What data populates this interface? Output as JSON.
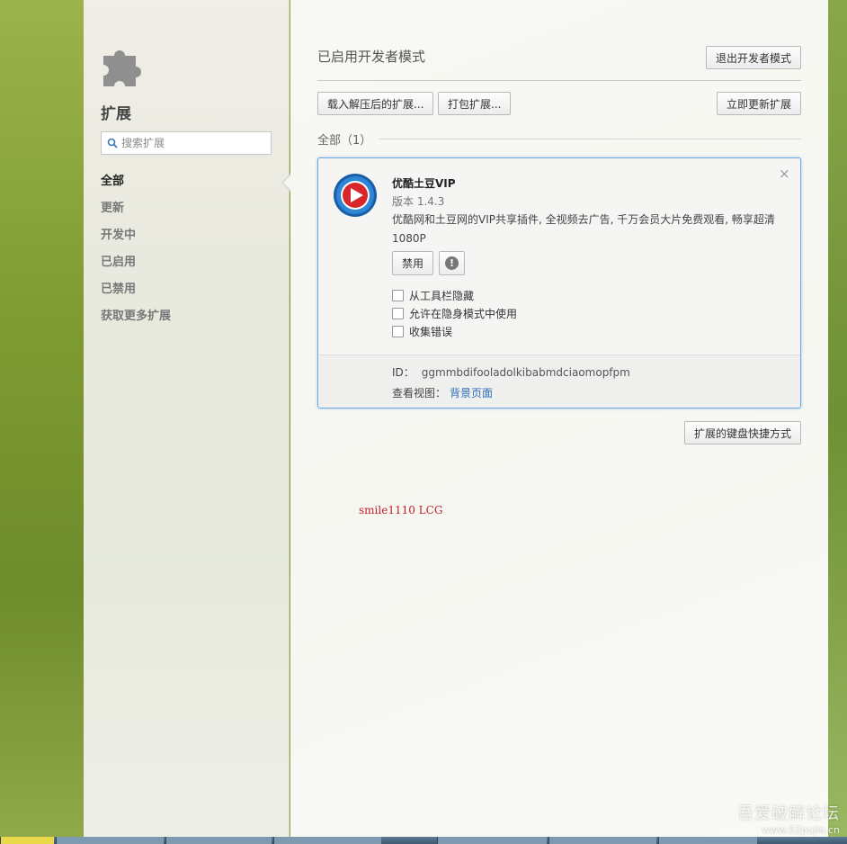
{
  "sidebar": {
    "title": "扩展",
    "search_placeholder": "搜索扩展",
    "items": [
      {
        "label": "全部",
        "active": true
      },
      {
        "label": "更新",
        "active": false
      },
      {
        "label": "开发中",
        "active": false
      },
      {
        "label": "已启用",
        "active": false
      },
      {
        "label": "已禁用",
        "active": false
      },
      {
        "label": "获取更多扩展",
        "active": false
      }
    ]
  },
  "main": {
    "dev_mode_title": "已启用开发者模式",
    "exit_dev_button": "退出开发者模式",
    "load_unpacked_button": "载入解压后的扩展...",
    "pack_button": "打包扩展...",
    "update_now_button": "立即更新扩展",
    "all_label": "全部（1）",
    "keyboard_shortcuts_button": "扩展的键盘快捷方式"
  },
  "extension": {
    "name": "优酷土豆VIP",
    "version": "版本 1.4.3",
    "description": "优酷网和土豆网的VIP共享插件, 全视频去广告, 千万会员大片免费观看, 畅享超清1080P",
    "disable_button": "禁用",
    "close_symbol": "×",
    "options": [
      {
        "label": "从工具栏隐藏",
        "checked": false
      },
      {
        "label": "允许在隐身模式中使用",
        "checked": false
      },
      {
        "label": "收集错误",
        "checked": false
      }
    ],
    "id_label": "ID：",
    "id_value": "ggmmbdifooladolkibabmdciaomopfpm",
    "view_label": "查看视图：",
    "view_link": "背景页面"
  },
  "watermark": "smile1110 LCG",
  "site_watermark": {
    "line1": "吾爱破解论坛",
    "line2": "www.52pojie.cn"
  },
  "colors": {
    "accent_border": "#6ea9df",
    "link": "#2a6fb8",
    "watermark": "#c0202a"
  }
}
